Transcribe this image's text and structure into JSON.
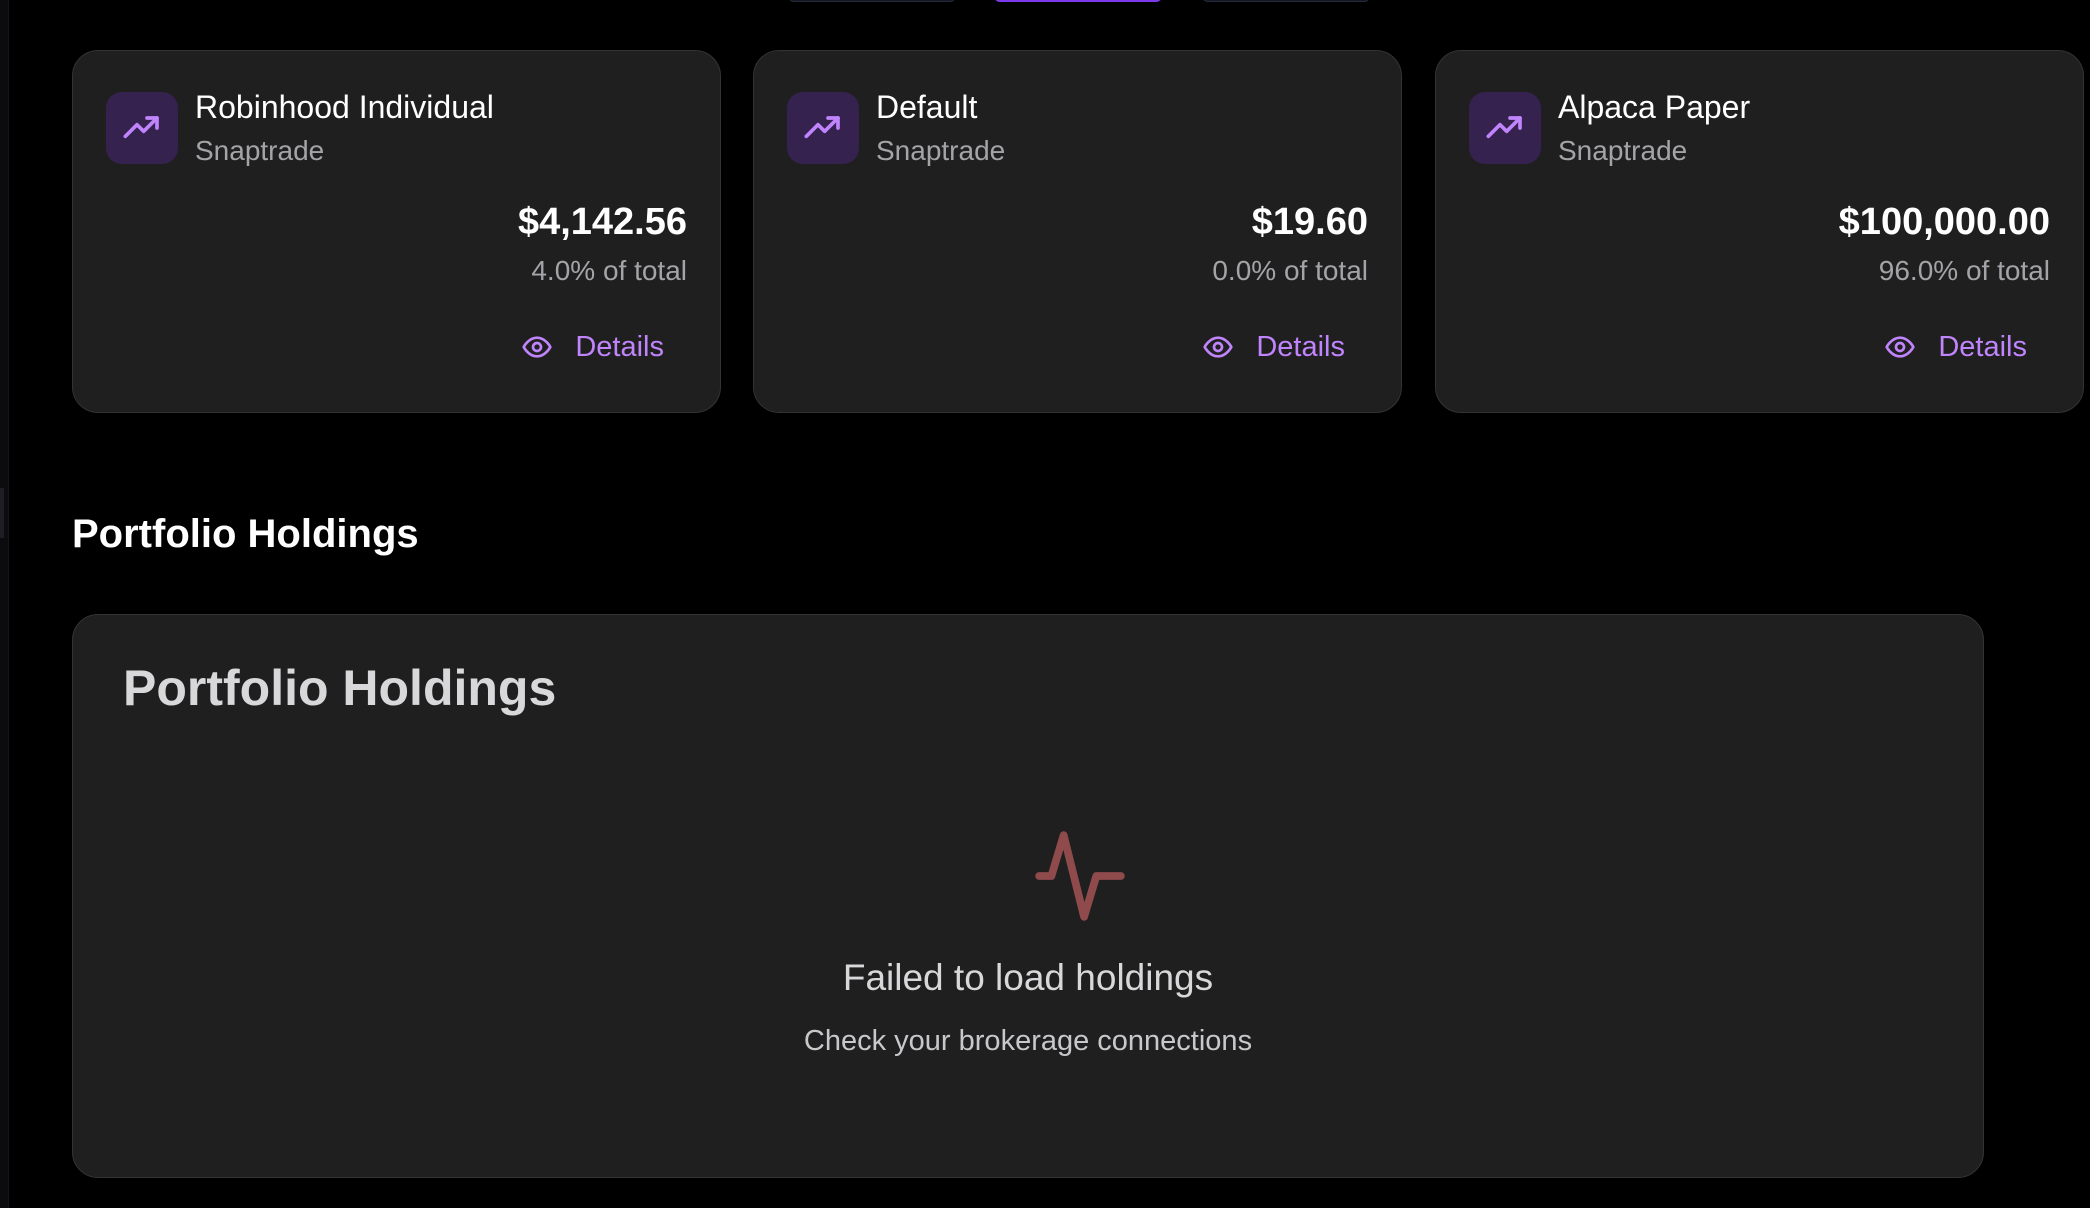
{
  "accounts": [
    {
      "name": "Robinhood Individual",
      "provider": "Snaptrade",
      "value": "$4,142.56",
      "share": "4.0% of total",
      "details_label": "Details",
      "icon": "trending-up-icon"
    },
    {
      "name": "Default",
      "provider": "Snaptrade",
      "value": "$19.60",
      "share": "0.0% of total",
      "details_label": "Details",
      "icon": "trending-up-icon"
    },
    {
      "name": "Alpaca Paper",
      "provider": "Snaptrade",
      "value": "$100,000.00",
      "share": "96.0% of total",
      "details_label": "Details",
      "icon": "trending-up-icon"
    }
  ],
  "holdings_section": {
    "heading": "Portfolio Holdings",
    "panel_title": "Portfolio Holdings",
    "empty_icon": "activity-pulse-icon",
    "error_title": "Failed to load holdings",
    "error_subtitle": "Check your brokerage connections"
  },
  "colors": {
    "accent": "#c084fc",
    "icon_tile": "#35224f",
    "card_background": "#1f1f1f",
    "error_icon": "#8f4a4c",
    "tab_active": "#7c3aed"
  }
}
